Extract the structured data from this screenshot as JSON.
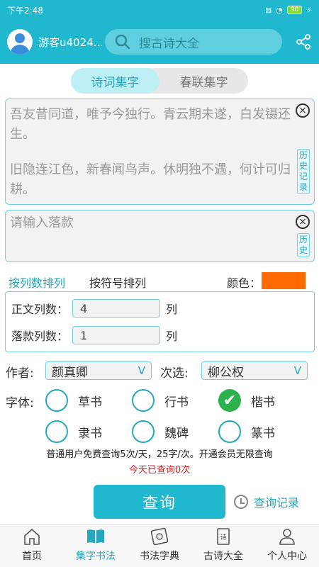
{
  "status": {
    "time": "下午2:48",
    "battery": "90"
  },
  "header": {
    "username": "游客u4024...",
    "search_placeholder": "搜古诗大全"
  },
  "segment": {
    "tabs": [
      "诗词集字",
      "春联集字"
    ],
    "active": 0
  },
  "poem": {
    "line1": "吾友昔同道，唯予今独行。青云期未遂，白发镊还生。",
    "line2": "旧隐连江色，新春闻鸟声。休明独不遇，何计可归耕。",
    "history_label": "历史记录"
  },
  "inscription": {
    "placeholder": "请输入落款",
    "history_label": "历史"
  },
  "sort": {
    "by_columns": "按列数排列",
    "by_symbol": "按符号排列",
    "color_label": "颜色：",
    "color_value": "#ff6a00"
  },
  "columns": {
    "body_label": "正文列数：",
    "body_value": "4",
    "body_unit": "列",
    "sign_label": "落款列数：",
    "sign_value": "1",
    "sign_unit": "列"
  },
  "author": {
    "label": "作者:",
    "value": "颜真卿",
    "second_label": "次选:",
    "second_value": "柳公权"
  },
  "fonts": {
    "label": "字体:",
    "options": [
      {
        "name": "草书",
        "selected": false
      },
      {
        "name": "行书",
        "selected": false
      },
      {
        "name": "楷书",
        "selected": true
      },
      {
        "name": "隶书",
        "selected": false
      },
      {
        "name": "魏碑",
        "selected": false
      },
      {
        "name": "篆书",
        "selected": false
      }
    ]
  },
  "notice": "普通用户免费查询5次/天，25字/次。开通会员无限查询",
  "today": "今天已查询0次",
  "query_button": "查询",
  "records_link": "查询记录",
  "tabbar": [
    "首页",
    "集字书法",
    "书法字典",
    "古诗大全",
    "个人中心"
  ],
  "colors": {
    "accent": "#20b8cf",
    "checked": "#2bb24c",
    "warning": "#dd2222"
  }
}
